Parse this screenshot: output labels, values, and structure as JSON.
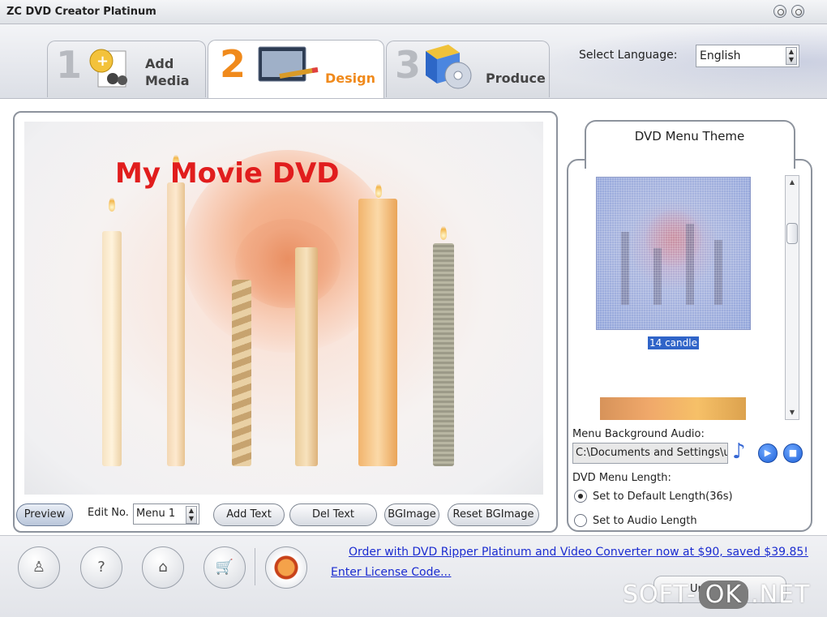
{
  "window": {
    "title": "ZC DVD Creator Platinum"
  },
  "tabs": [
    {
      "num": "1",
      "label_line1": "Add",
      "label_line2": "Media",
      "icon": "add-media-icon"
    },
    {
      "num": "2",
      "label": "Design",
      "icon": "design-icon",
      "active": true
    },
    {
      "num": "3",
      "label": "Produce",
      "icon": "produce-icon"
    }
  ],
  "language": {
    "label": "Select Language:",
    "value": "English"
  },
  "preview": {
    "title_text": "My Movie DVD"
  },
  "buttons": {
    "preview": "Preview",
    "edit_no_label": "Edit No.",
    "edit_no_value": "Menu 1",
    "add_text": "Add Text",
    "del_text": "Del Text",
    "bgimage": "BGImage",
    "reset_bgimage": "Reset BGImage"
  },
  "theme": {
    "title": "DVD Menu Theme",
    "selected_label": "14 candle"
  },
  "audio": {
    "label": "Menu Background Audio:",
    "path": "C:\\Documents and Settings\\u",
    "length_label": "DVD Menu Length:",
    "option_default": "Set to Default Length(36s)",
    "option_audio": "Set to Audio Length",
    "selected": "default"
  },
  "footer": {
    "order_link": "Order with DVD Ripper Platinum and Video Converter now at $90, saved $39.85!",
    "license_link": "Enter License Code...",
    "project_name": "Untitled"
  },
  "watermark": {
    "prefix": "SOFT-",
    "mid": "OK",
    "suffix": ".NET"
  }
}
